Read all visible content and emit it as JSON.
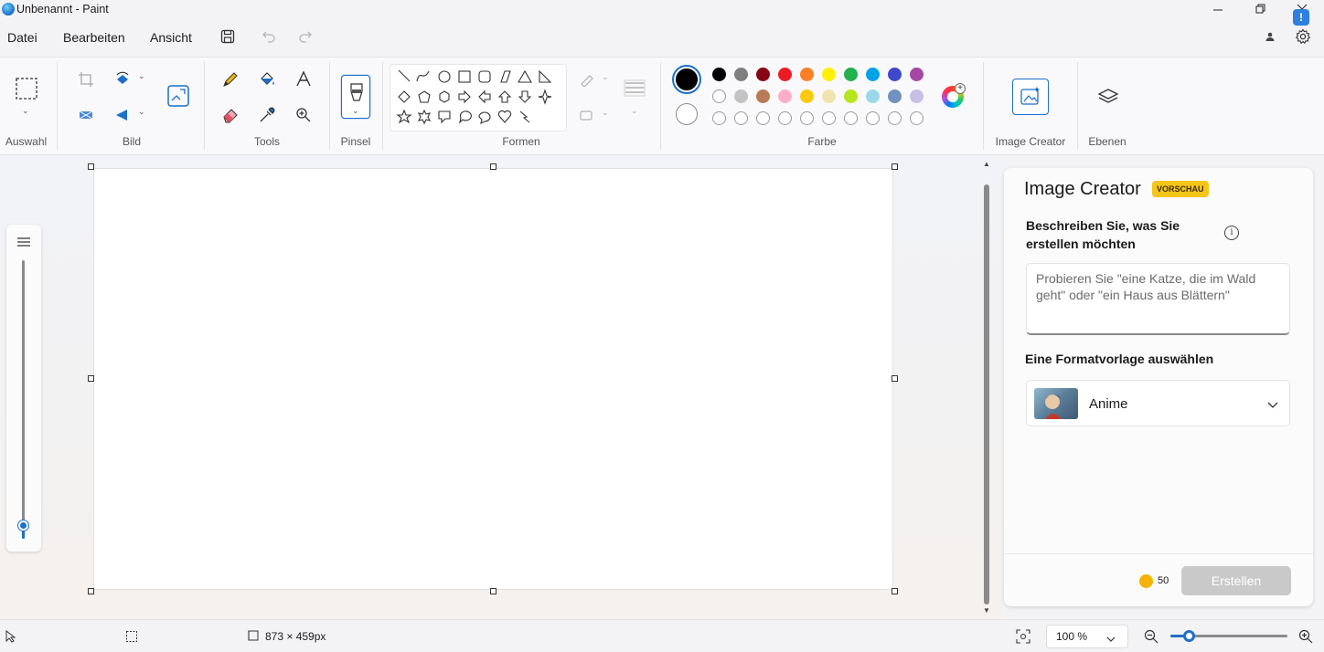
{
  "window": {
    "title": "Unbenannt - Paint"
  },
  "menu": {
    "file": "Datei",
    "edit": "Bearbeiten",
    "view": "Ansicht"
  },
  "ribbon": {
    "groups": {
      "selection": "Auswahl",
      "image": "Bild",
      "tools": "Tools",
      "brushes": "Pinsel",
      "shapes": "Formen",
      "colors": "Farbe",
      "image_creator": "Image Creator",
      "layers": "Ebenen"
    },
    "palette": {
      "row1": [
        "#000000",
        "#7f7f7f",
        "#880015",
        "#ed1c24",
        "#ff7f27",
        "#fff200",
        "#22b14c",
        "#00a2e8",
        "#3f48cc",
        "#a349a4"
      ],
      "row2": [
        "#ffffff",
        "#c3c3c3",
        "#b97a57",
        "#ffaec9",
        "#ffc90e",
        "#efe4b0",
        "#b5e61d",
        "#99d9ea",
        "#7092be",
        "#c8bfe7"
      ],
      "row3_empty_count": 10
    },
    "primary_color": "#000000",
    "secondary_color": "#ffffff"
  },
  "image_creator": {
    "title": "Image Creator",
    "badge": "VORSCHAU",
    "description_label": "Beschreiben Sie, was Sie erstellen möchten",
    "prompt_placeholder": "Probieren Sie \"eine Katze, die im Wald geht\" oder \"ein Haus aus Blättern\"",
    "format_label": "Eine Formatvorlage auswählen",
    "style_selected": "Anime",
    "credits": "50",
    "create_button": "Erstellen"
  },
  "status": {
    "canvas_size": "873 × 459px",
    "zoom": "100 %"
  },
  "zoom_slider_level": 0.16
}
